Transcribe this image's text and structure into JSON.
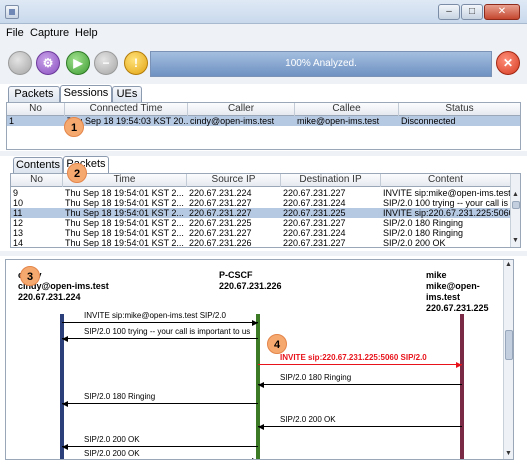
{
  "window": {
    "minimize_label": "–",
    "maximize_label": "□",
    "close_label": "✕"
  },
  "menu": [
    "File",
    "Capture",
    "Help"
  ],
  "toolbar": {
    "buttons": [
      {
        "name": "stop-button",
        "icon": "gray-circle-icon",
        "glyph": ""
      },
      {
        "name": "settings-button",
        "icon": "gear-icon",
        "glyph": "⚙"
      },
      {
        "name": "start-button",
        "icon": "play-icon",
        "glyph": "▶"
      },
      {
        "name": "pause-button",
        "icon": "minus-icon",
        "glyph": "−"
      },
      {
        "name": "warning-button",
        "icon": "exclamation-icon",
        "glyph": "!"
      },
      {
        "name": "clear-button",
        "icon": "close-icon",
        "glyph": "✕"
      }
    ],
    "progress_text": "100% Analyzed.",
    "progress_fraction": 1.0
  },
  "top_panel": {
    "tabs": [
      "Packets",
      "Sessions",
      "UEs"
    ],
    "active_tab": 1,
    "columns": [
      "No",
      "Connected Time",
      "Caller",
      "Callee",
      "Status"
    ],
    "rows": [
      [
        "1",
        "Thu Sep 18 19:54:03 KST 20...",
        "cindy@open-ims.test",
        "mike@open-ims.test",
        "Disconnected"
      ]
    ]
  },
  "bottom_panel": {
    "tabs": [
      "Contents",
      "Packets"
    ],
    "active_tab": 1,
    "columns": [
      "No",
      "Time",
      "Source IP",
      "Destination IP",
      "Content"
    ],
    "rows": [
      [
        "9",
        "Thu Sep 18 19:54:01 KST 2...",
        "220.67.231.224",
        "220.67.231.227",
        "INVITE sip:mike@open-ims.test SIP/..."
      ],
      [
        "10",
        "Thu Sep 18 19:54:01 KST 2...",
        "220.67.231.227",
        "220.67.231.224",
        "SIP/2.0 100 trying -- your call is import..."
      ],
      [
        "11",
        "Thu Sep 18 19:54:01 KST 2...",
        "220.67.231.227",
        "220.67.231.225",
        "INVITE sip:220.67.231.225:5060 SIP/2.0"
      ],
      [
        "12",
        "Thu Sep 18 19:54:01 KST 2...",
        "220.67.231.225",
        "220.67.231.227",
        "SIP/2.0 180 Ringing"
      ],
      [
        "13",
        "Thu Sep 18 19:54:01 KST 2...",
        "220.67.231.227",
        "220.67.231.224",
        "SIP/2.0 180 Ringing"
      ],
      [
        "14",
        "Thu Sep 18 19:54:01 KST 2...",
        "220.67.231.226",
        "220.67.231.227",
        "SIP/2.0 200 OK"
      ]
    ],
    "selected_row": 2
  },
  "diagram": {
    "parties": [
      {
        "name": "cindy",
        "name2": "cindy@open-ims.test",
        "ip": "220.67.231.224",
        "color": "#2b3f7a"
      },
      {
        "name": "",
        "name2": "P-CSCF",
        "ip": "220.67.231.226",
        "color": "#3d7a25"
      },
      {
        "name": "mike",
        "name2": "mike@open-ims.test",
        "ip": "220.67.231.225",
        "color": "#7a2a45"
      }
    ],
    "messages": [
      {
        "text": "INVITE sip:mike@open-ims.test SIP/2.0",
        "from": 0,
        "to": 1,
        "highlight": false
      },
      {
        "text": "SIP/2.0 100 trying -- your call is important to us",
        "from": 1,
        "to": 0,
        "highlight": false
      },
      {
        "text": "INVITE sip:220.67.231.225:5060 SIP/2.0",
        "from": 1,
        "to": 2,
        "highlight": true
      },
      {
        "text": "SIP/2.0 180 Ringing",
        "from": 2,
        "to": 1,
        "highlight": false
      },
      {
        "text": "SIP/2.0 180 Ringing",
        "from": 1,
        "to": 0,
        "highlight": false
      },
      {
        "text": "SIP/2.0 200 OK",
        "from": 2,
        "to": 1,
        "highlight": false
      },
      {
        "text": "SIP/2.0 200 OK",
        "from": 1,
        "to": 0,
        "highlight": false
      },
      {
        "text": "SIP/2.0 200 OK",
        "from": 0,
        "to": 1,
        "highlight": false
      }
    ],
    "highlight_color": "#e8121a"
  },
  "badges": [
    "1",
    "2",
    "3",
    "4"
  ]
}
